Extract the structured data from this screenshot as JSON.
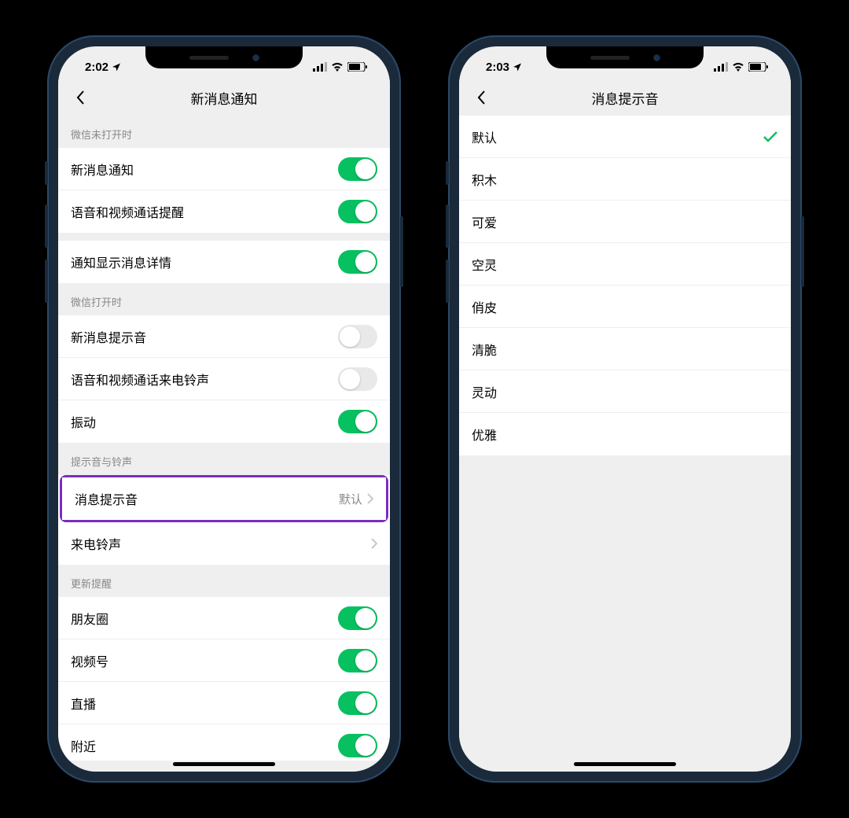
{
  "phone1": {
    "status": {
      "time": "2:02"
    },
    "nav": {
      "title": "新消息通知"
    },
    "sections": {
      "s1_header": "微信未打开时",
      "s1_rows": [
        {
          "label": "新消息通知",
          "toggle": true
        },
        {
          "label": "语音和视频通话提醒",
          "toggle": true
        }
      ],
      "s1b_rows": [
        {
          "label": "通知显示消息详情",
          "toggle": true
        }
      ],
      "s2_header": "微信打开时",
      "s2_rows": [
        {
          "label": "新消息提示音",
          "toggle": false
        },
        {
          "label": "语音和视频通话来电铃声",
          "toggle": false
        },
        {
          "label": "振动",
          "toggle": true
        }
      ],
      "s3_header": "提示音与铃声",
      "s3_rows": [
        {
          "label": "消息提示音",
          "value": "默认",
          "highlight": true
        },
        {
          "label": "来电铃声",
          "value": ""
        }
      ],
      "s4_header": "更新提醒",
      "s4_rows": [
        {
          "label": "朋友圈",
          "toggle": true
        },
        {
          "label": "视频号",
          "toggle": true
        },
        {
          "label": "直播",
          "toggle": true
        },
        {
          "label": "附近",
          "toggle": true
        }
      ]
    }
  },
  "phone2": {
    "status": {
      "time": "2:03"
    },
    "nav": {
      "title": "消息提示音"
    },
    "options": [
      {
        "label": "默认",
        "selected": true
      },
      {
        "label": "积木",
        "selected": false
      },
      {
        "label": "可爱",
        "selected": false
      },
      {
        "label": "空灵",
        "selected": false
      },
      {
        "label": "俏皮",
        "selected": false
      },
      {
        "label": "清脆",
        "selected": false
      },
      {
        "label": "灵动",
        "selected": false
      },
      {
        "label": "优雅",
        "selected": false
      }
    ]
  }
}
